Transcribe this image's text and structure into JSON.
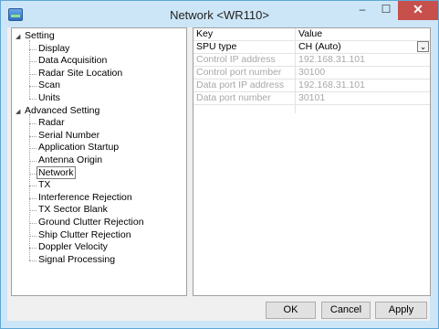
{
  "window": {
    "title": "Network <WR110>",
    "min_glyph": "–",
    "max_glyph": "☐",
    "close_glyph": "✕"
  },
  "tree": {
    "groups": [
      {
        "label": "Setting",
        "expander": "◢",
        "children": [
          "Display",
          "Data Acquisition",
          "Radar Site Location",
          "Scan",
          "Units"
        ]
      },
      {
        "label": "Advanced Setting",
        "expander": "◢",
        "children": [
          "Radar",
          "Serial Number",
          "Application Startup",
          "Antenna Origin",
          "Network",
          "TX",
          "Interference Rejection",
          "TX Sector Blank",
          "Ground Clutter Rejection",
          "Ship Clutter Rejection",
          "Doppler Velocity",
          "Signal Processing"
        ]
      }
    ],
    "selected": "Network"
  },
  "grid": {
    "header": {
      "key": "Key",
      "value": "Value"
    },
    "rows": [
      {
        "key": "SPU type",
        "value": "CH (Auto)",
        "enabled": true,
        "dropdown": true
      },
      {
        "key": "Control IP address",
        "value": "192.168.31.101",
        "enabled": false
      },
      {
        "key": "Control port number",
        "value": "30100",
        "enabled": false
      },
      {
        "key": "Data port IP address",
        "value": "192.168.31.101",
        "enabled": false
      },
      {
        "key": "Data port number",
        "value": "30101",
        "enabled": false
      }
    ],
    "dropdown_glyph": "⌄"
  },
  "buttons": {
    "ok": "OK",
    "cancel": "Cancel",
    "apply": "Apply"
  }
}
